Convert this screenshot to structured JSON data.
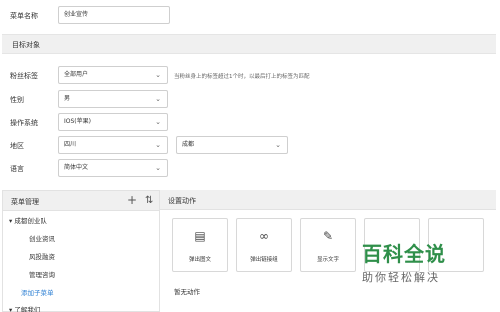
{
  "form": {
    "menu_name_label": "菜单名称",
    "menu_name_value": "创业宣传",
    "section_title": "目标对象",
    "fans_tag_label": "粉丝标签",
    "fans_tag_value": "全部用户",
    "fans_tag_hint": "当粉丝身上的标签超过1个时，以最后打上的标签为匹配",
    "gender_label": "性别",
    "gender_value": "男",
    "os_label": "操作系统",
    "os_value": "IOS(苹果)",
    "region_label": "地区",
    "region_province": "四川",
    "region_city": "成都",
    "language_label": "语言",
    "language_value": "简体中文"
  },
  "menu_manager": {
    "title": "菜单管理",
    "add_icon": "plus-icon",
    "sort_icon": "sort-icon",
    "items": [
      {
        "label": "▾ 成都创业队"
      },
      {
        "label": "创业资讯"
      },
      {
        "label": "风投融资"
      },
      {
        "label": "管理咨询"
      },
      {
        "label": "添加子菜单"
      },
      {
        "label": "▾ 了解我们"
      }
    ]
  },
  "actions": {
    "title": "设置动作",
    "cards": [
      {
        "icon": "message-icon",
        "label": "弹出图文"
      },
      {
        "icon": "link-icon",
        "label": "弹出链接组"
      },
      {
        "icon": "pencil-icon",
        "label": "显示文字"
      },
      {
        "icon": "blank",
        "label": ""
      },
      {
        "icon": "blank",
        "label": ""
      }
    ],
    "none_text": "暂无动作"
  },
  "watermark": {
    "main": "百科全说",
    "sub": "助你轻松解决"
  }
}
